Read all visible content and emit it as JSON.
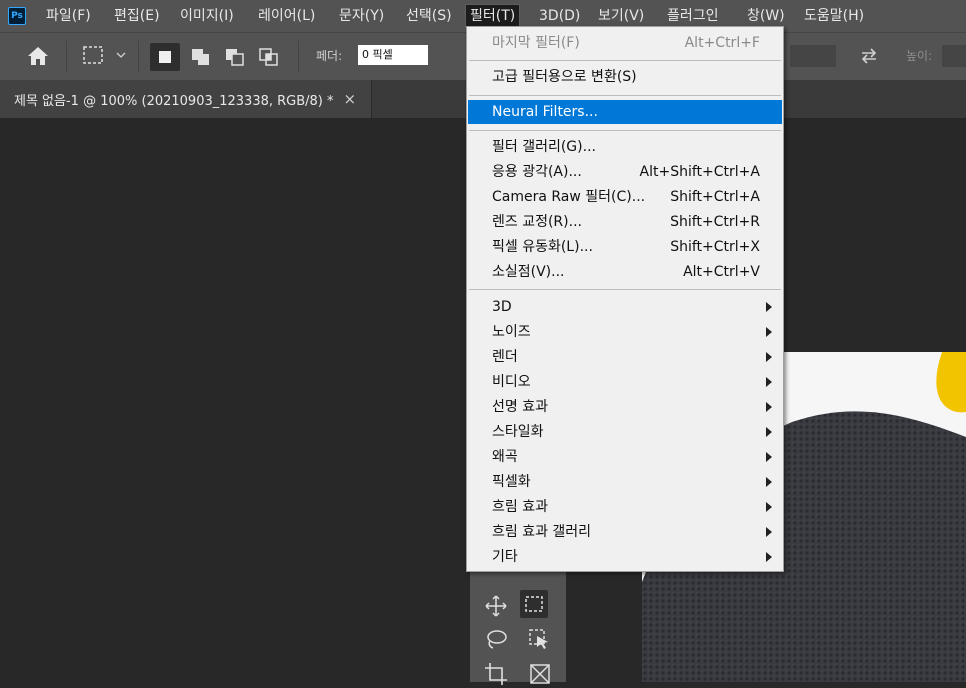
{
  "app": {
    "logo": "Ps"
  },
  "menubar": {
    "items": [
      {
        "label": "파일(F)"
      },
      {
        "label": "편집(E)"
      },
      {
        "label": "이미지(I)"
      },
      {
        "label": "레이어(L)"
      },
      {
        "label": "문자(Y)"
      },
      {
        "label": "선택(S)"
      },
      {
        "label": "필터(T)"
      },
      {
        "label": "3D(D)"
      },
      {
        "label": "보기(V)"
      },
      {
        "label": "플러그인"
      },
      {
        "label": "창(W)"
      },
      {
        "label": "도움말(H)"
      }
    ],
    "active_index": 6
  },
  "options": {
    "feather_label": "페더:",
    "feather_value": "0 픽셀",
    "height_label": "높이:"
  },
  "document_tab": {
    "title": "제목 없음-1 @ 100% (20210903_123338, RGB/8) *",
    "close": "×"
  },
  "filter_menu": {
    "last_filter": {
      "label": "마지막 필터(F)",
      "shortcut": "Alt+Ctrl+F"
    },
    "convert": {
      "label": "고급 필터용으로 변환(S)"
    },
    "neural": {
      "label": "Neural Filters..."
    },
    "group1": [
      {
        "label": "필터 갤러리(G)...",
        "shortcut": ""
      },
      {
        "label": "응용 광각(A)...",
        "shortcut": "Alt+Shift+Ctrl+A"
      },
      {
        "label": "Camera Raw 필터(C)...",
        "shortcut": "Shift+Ctrl+A"
      },
      {
        "label": "렌즈 교정(R)...",
        "shortcut": "Shift+Ctrl+R"
      },
      {
        "label": "픽셀 유동화(L)...",
        "shortcut": "Shift+Ctrl+X"
      },
      {
        "label": "소실점(V)...",
        "shortcut": "Alt+Ctrl+V"
      }
    ],
    "submenus": [
      {
        "label": "3D"
      },
      {
        "label": "노이즈"
      },
      {
        "label": "렌더"
      },
      {
        "label": "비디오"
      },
      {
        "label": "선명 효과"
      },
      {
        "label": "스타일화"
      },
      {
        "label": "왜곡"
      },
      {
        "label": "픽셀화"
      },
      {
        "label": "흐림 효과"
      },
      {
        "label": "흐림 효과 갤러리"
      },
      {
        "label": "기타"
      }
    ]
  },
  "colors": {
    "highlight": "#0078d7",
    "menu_bg": "#f0f0f0",
    "chrome": "#535353",
    "canvas_bg": "#282828"
  }
}
